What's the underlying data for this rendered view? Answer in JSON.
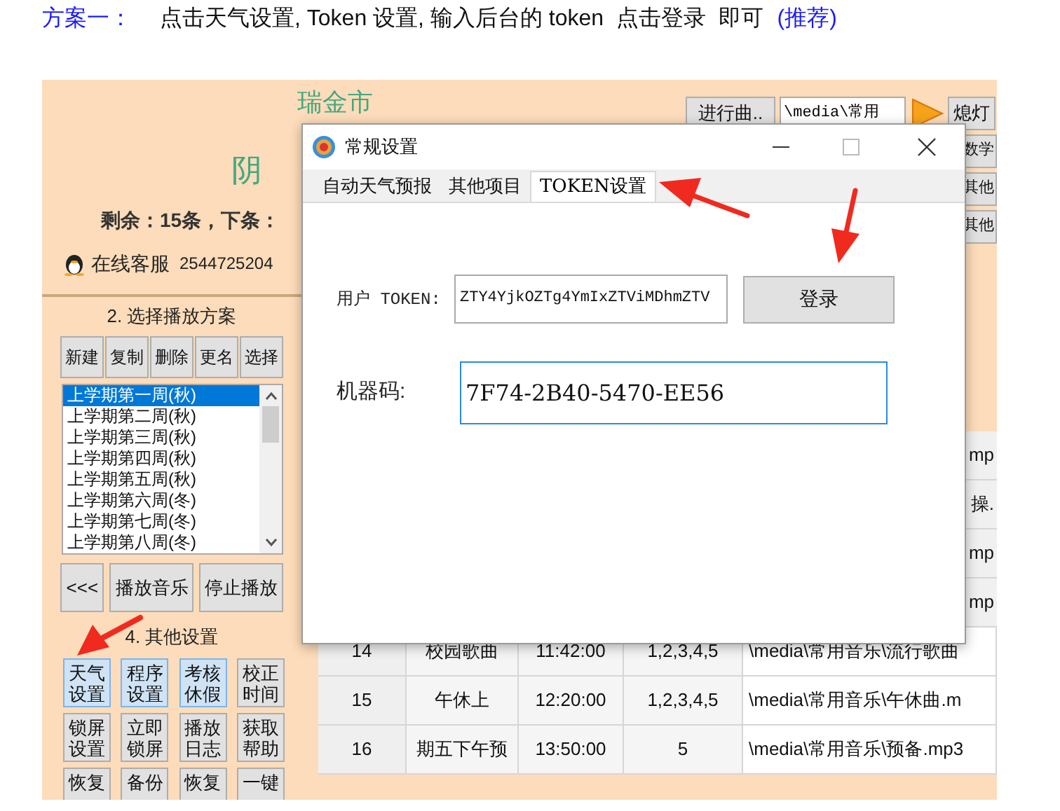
{
  "instruction": {
    "label": "方案一：",
    "text": "点击天气设置, Token 设置, 输入后台的 token  点击登录  即可",
    "note": "(推荐)"
  },
  "app": {
    "header": {
      "city": "瑞金市",
      "weather": "阴",
      "remaining": "剩余：15条，下条：",
      "support_label": "在线客服",
      "support_number": "2544725204"
    },
    "bell_rows": [
      {
        "kind": "full",
        "button": "进行曲..",
        "path": "\\media\\常用",
        "action": "熄灯"
      },
      {
        "kind": "partial",
        "action": "数学"
      },
      {
        "kind": "partial",
        "action": "其他"
      },
      {
        "kind": "partial",
        "action": "其他"
      }
    ],
    "plan_section": {
      "title": "2. 选择播放方案",
      "buttons": [
        "新建",
        "复制",
        "删除",
        "更名",
        "选择"
      ],
      "plans": [
        {
          "label": "上学期第一周(秋)",
          "selected": true
        },
        {
          "label": "上学期第二周(秋)",
          "selected": false
        },
        {
          "label": "上学期第三周(秋)",
          "selected": false
        },
        {
          "label": "上学期第四周(秋)",
          "selected": false
        },
        {
          "label": "上学期第五周(秋)",
          "selected": false
        },
        {
          "label": "上学期第六周(冬)",
          "selected": false
        },
        {
          "label": "上学期第七周(冬)",
          "selected": false
        },
        {
          "label": "上学期第八周(冬)",
          "selected": false
        }
      ],
      "controls": [
        "<<<",
        "播放音乐",
        "停止播放"
      ]
    },
    "other_section": {
      "title": "4. 其他设置",
      "buttons": [
        {
          "label": "天气设置",
          "highlighted": true
        },
        {
          "label": "程序设置",
          "highlighted": true
        },
        {
          "label": "考核休假",
          "highlighted": true
        },
        {
          "label": "校正时间",
          "highlighted": false
        },
        {
          "label": "锁屏设置",
          "highlighted": false
        },
        {
          "label": "立即锁屏",
          "highlighted": false
        },
        {
          "label": "播放日志",
          "highlighted": false
        },
        {
          "label": "获取帮助",
          "highlighted": false
        },
        {
          "label": "恢复",
          "highlighted": false
        },
        {
          "label": "备份",
          "highlighted": false
        },
        {
          "label": "恢复",
          "highlighted": false
        },
        {
          "label": "一键",
          "highlighted": false
        }
      ]
    },
    "table": {
      "rows": [
        {
          "kind": "fragment",
          "text": "mp"
        },
        {
          "kind": "fragment",
          "text": "操."
        },
        {
          "kind": "fragment",
          "text": "mp"
        },
        {
          "kind": "fragment",
          "text": "mp"
        },
        {
          "kind": "row",
          "cells": [
            "14",
            "校园歌曲",
            "11:42:00",
            "1,2,3,4,5",
            "\\media\\常用音乐\\流行歌曲"
          ]
        },
        {
          "kind": "row",
          "cells": [
            "15",
            "午休上",
            "12:20:00",
            "1,2,3,4,5",
            "\\media\\常用音乐\\午休曲.m"
          ]
        },
        {
          "kind": "row",
          "cells": [
            "16",
            "期五下午预",
            "13:50:00",
            "5",
            "\\media\\常用音乐\\预备.mp3"
          ]
        }
      ]
    }
  },
  "dialog": {
    "title": "常规设置",
    "tabs": [
      {
        "label": "自动天气预报",
        "selected": false
      },
      {
        "label": "其他项目",
        "selected": false
      },
      {
        "label": "TOKEN设置",
        "selected": true
      }
    ],
    "token_label": "用户 TOKEN:",
    "token_value": "ZTY4YjkOZTg4YmIxZTViMDhmZTV",
    "login_button": "登录",
    "machine_label": "机器码:",
    "machine_value": "7F74-2B40-5470-EE56"
  }
}
